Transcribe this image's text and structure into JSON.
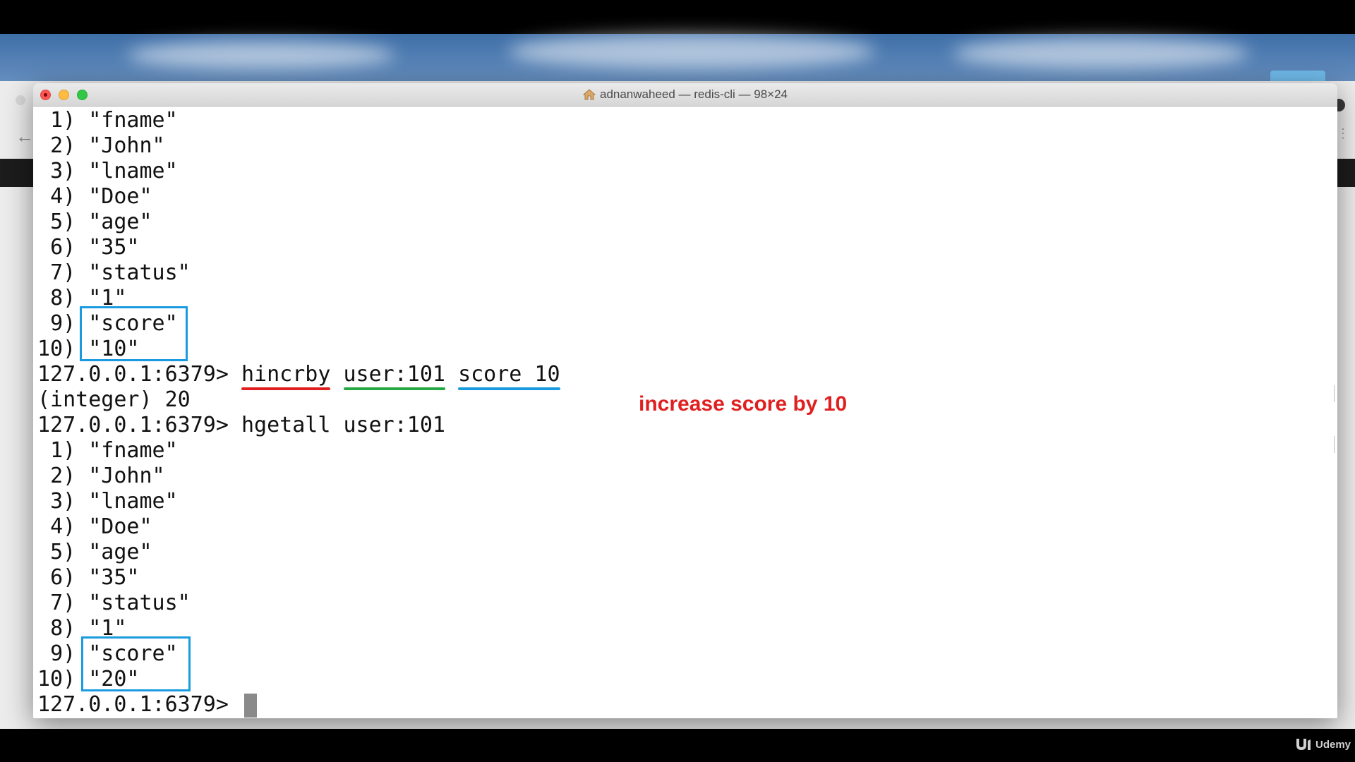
{
  "window": {
    "title": "adnanwaheed — redis-cli — 98×24",
    "home_icon": "home-icon"
  },
  "terminal": {
    "lines": [
      "1) \"fname\"",
      "2) \"John\"",
      "3) \"lname\"",
      "4) \"Doe\"",
      "5) \"age\"",
      "6) \"35\"",
      "7) \"status\"",
      "8) \"1\"",
      "9) \"score\"",
      "10) \"10\""
    ],
    "command1": {
      "prompt": "127.0.0.1:6379>",
      "cmd": "hincrby",
      "key": "user:101",
      "args": "score 10"
    },
    "result1": "(integer) 20",
    "command2": {
      "prompt": "127.0.0.1:6379>",
      "cmd": "hgetall user:101"
    },
    "lines2": [
      "1) \"fname\"",
      "2) \"John\"",
      "3) \"lname\"",
      "4) \"Doe\"",
      "5) \"age\"",
      "6) \"35\"",
      "7) \"status\"",
      "8) \"1\"",
      "9) \"score\"",
      "10) \"20\""
    ],
    "final_prompt": "127.0.0.1:6379>"
  },
  "annotation": {
    "text": "increase score by 10",
    "color": "#e02020"
  },
  "highlight_colors": {
    "command": "#e02020",
    "key": "#28a745",
    "field_value": "#1a9be0",
    "box": "#1a9be0"
  },
  "watermark": {
    "brand": "Udemy"
  }
}
